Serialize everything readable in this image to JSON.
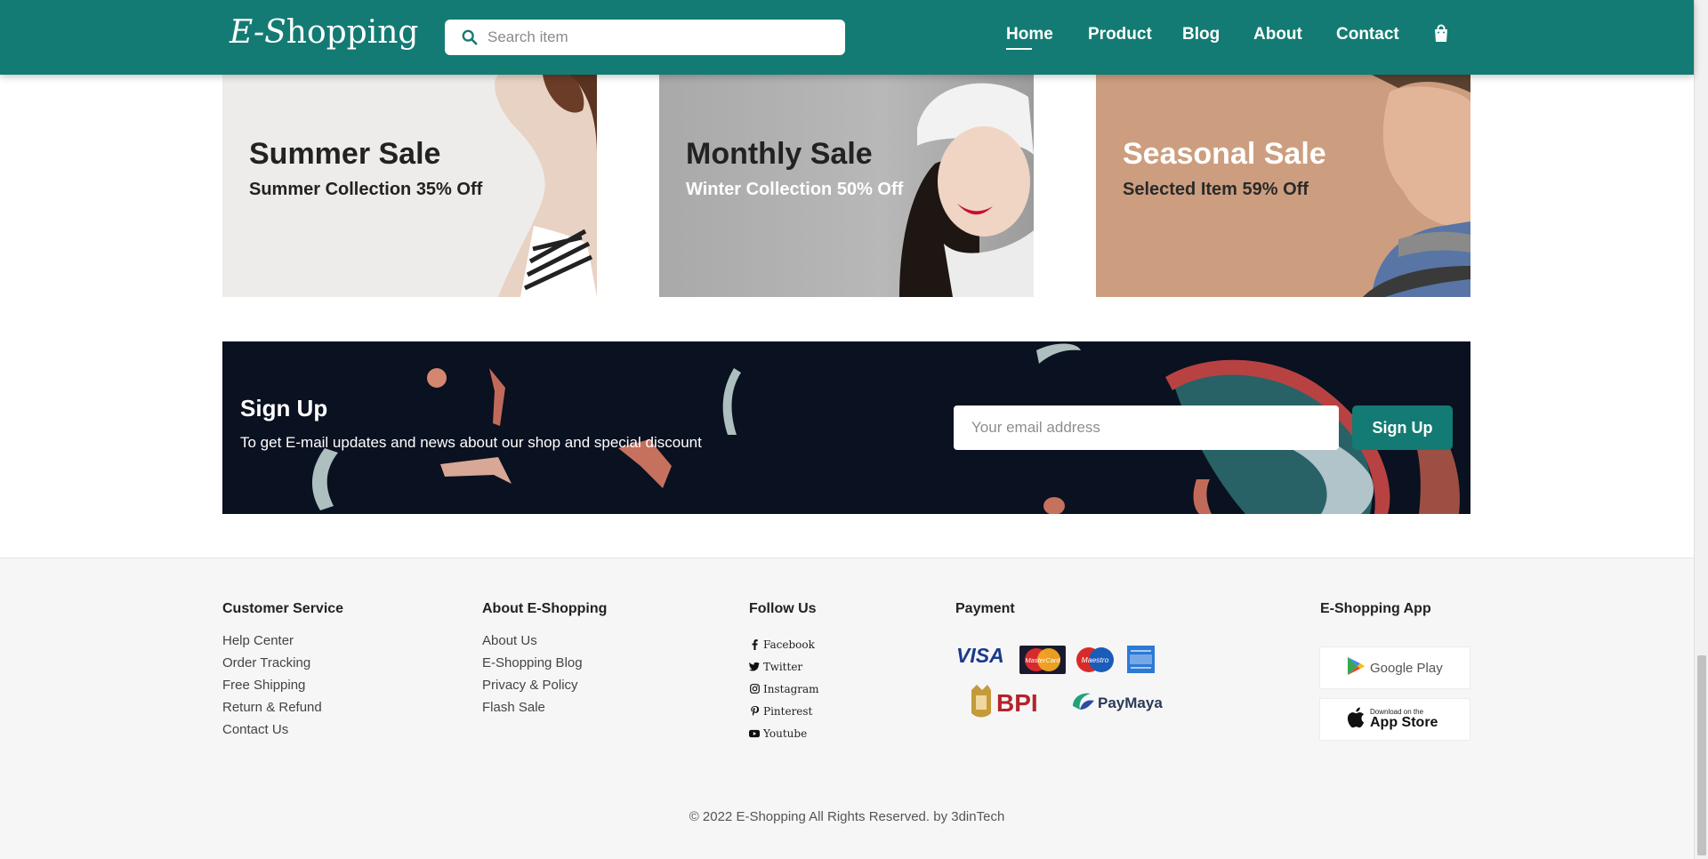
{
  "nav": {
    "logo": {
      "prefix": "E-S",
      "rest": "hopping"
    },
    "search_placeholder": "Search item",
    "links": [
      "Home",
      "Product",
      "Blog",
      "About",
      "Contact"
    ],
    "active": "Home"
  },
  "banners": [
    {
      "title": "Summer Sale",
      "subtitle": "Summer Collection 35% Off"
    },
    {
      "title": "Monthly Sale",
      "subtitle": "Winter Collection 50% Off"
    },
    {
      "title": "Seasonal Sale",
      "subtitle": "Selected Item 59% Off"
    }
  ],
  "signup": {
    "title": "Sign Up",
    "description": "To get E-mail updates and news about our shop and special discount",
    "email_placeholder": "Your email address",
    "button": "Sign Up"
  },
  "footer": {
    "customer_service": {
      "heading": "Customer Service",
      "items": [
        "Help Center",
        "Order Tracking",
        "Free Shipping",
        "Return & Refund",
        "Contact Us"
      ]
    },
    "about": {
      "heading": "About E-Shopping",
      "items": [
        "About Us",
        "E-Shopping Blog",
        "Privacy & Policy",
        "Flash Sale"
      ]
    },
    "follow": {
      "heading": "Follow Us",
      "items": [
        "Facebook",
        "Twitter",
        "Instagram",
        "Pinterest",
        "Youtube"
      ]
    },
    "payment": {
      "heading": "Payment",
      "methods": [
        "VISA",
        "MasterCard",
        "Maestro",
        "BPI",
        "PayMaya"
      ]
    },
    "app": {
      "heading": "E-Shopping App",
      "google_play": "Google Play",
      "app_store_small": "Download on the",
      "app_store": "App Store"
    },
    "copyright": "© 2022 E-Shopping All Rights Reserved. by 3dinTech"
  },
  "colors": {
    "brand": "#137b73",
    "signup_bg": "#0a1120"
  }
}
